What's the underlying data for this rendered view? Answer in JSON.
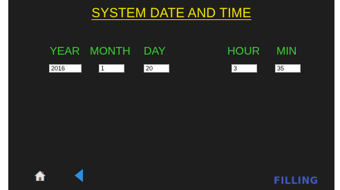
{
  "title": "SYSTEM DATE AND TIME",
  "labels": {
    "year": "YEAR",
    "month": "MONTH",
    "day": "DAY",
    "hour": "HOUR",
    "min": "MIN"
  },
  "fields": {
    "year": "2016",
    "month": "1",
    "day": "20",
    "hour": "3",
    "min": "35"
  },
  "icons": {
    "home": "home-icon",
    "back": "back-arrow-icon"
  },
  "status": {
    "mode": "FILLING"
  },
  "colors": {
    "background": "#1e1e1e",
    "title": "#f2e600",
    "labels": "#3fcf3a",
    "status": "#3f59c4",
    "back_arrow": "#2f8fe0"
  }
}
